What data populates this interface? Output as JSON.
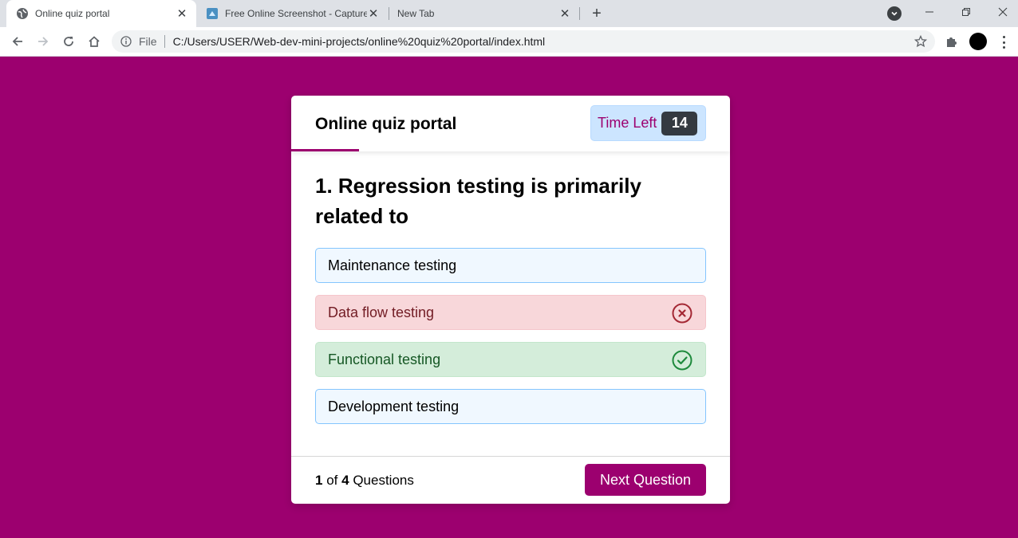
{
  "browser": {
    "tabs": [
      {
        "title": "Online quiz portal",
        "icon": "globe-icon",
        "active": true
      },
      {
        "title": "Free Online Screenshot - Capture",
        "icon": "screenshot-app-icon",
        "active": false
      },
      {
        "title": "New Tab",
        "icon": "",
        "active": false
      }
    ],
    "address": {
      "scheme_label": "File",
      "url": "C:/Users/USER/Web-dev-mini-projects/online%20quiz%20portal/index.html"
    }
  },
  "quiz": {
    "title": "Online quiz portal",
    "time_label": "Time Left",
    "time_value": "14",
    "question": "1. Regression testing is primarily related to",
    "options": [
      {
        "label": "Maintenance testing",
        "state": "default"
      },
      {
        "label": "Data flow testing",
        "state": "wrong",
        "icon": "cross-circle-icon"
      },
      {
        "label": "Functional testing",
        "state": "correct",
        "icon": "check-circle-icon"
      },
      {
        "label": "Development testing",
        "state": "default"
      }
    ],
    "footer": {
      "current": "1",
      "of_text": "of",
      "total": "4",
      "questions_text": "Questions",
      "next_label": "Next Question"
    }
  },
  "colors": {
    "brand": "#9c006f",
    "wrong": "#a42834",
    "correct": "#1e8a3c"
  }
}
